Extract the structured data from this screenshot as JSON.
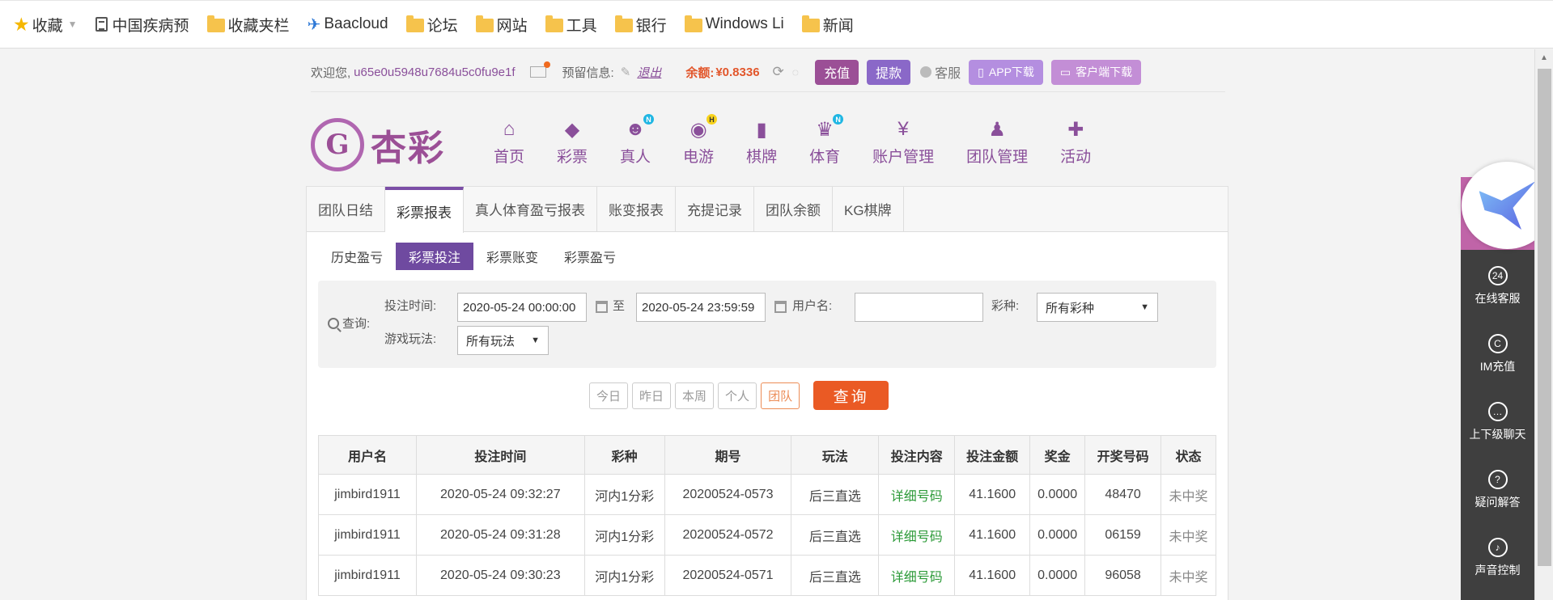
{
  "bookmarks": [
    {
      "label": "收藏",
      "type": "star"
    },
    {
      "label": "中国疾病预",
      "type": "doc"
    },
    {
      "label": "收藏夹栏",
      "type": "folder"
    },
    {
      "label": "Baacloud",
      "type": "plane"
    },
    {
      "label": "论坛",
      "type": "folder"
    },
    {
      "label": "网站",
      "type": "folder"
    },
    {
      "label": "工具",
      "type": "folder"
    },
    {
      "label": "银行",
      "type": "folder"
    },
    {
      "label": "Windows Li",
      "type": "folder"
    },
    {
      "label": "新闻",
      "type": "folder"
    }
  ],
  "topbar": {
    "welcome": "欢迎您,",
    "username": "u65e0u5948u7684u5c0fu9e1f",
    "reserve": "预留信息:",
    "logout": "退出",
    "balance_label": "余额:",
    "balance": "¥0.8336",
    "recharge": "充值",
    "withdraw": "提款",
    "service": "客服",
    "app_download": "APP下载",
    "client_download": "客户端下载"
  },
  "logo": {
    "text": "杏彩"
  },
  "nav": [
    "首页",
    "彩票",
    "真人",
    "电游",
    "棋牌",
    "体育",
    "账户管理",
    "团队管理",
    "活动"
  ],
  "nav_badges": {
    "zhenren": "N",
    "dianyou": "H",
    "tiyu": "N"
  },
  "tabs": [
    "团队日结",
    "彩票报表",
    "真人体育盈亏报表",
    "账变报表",
    "充提记录",
    "团队余额",
    "KG棋牌"
  ],
  "subtabs": [
    "历史盈亏",
    "彩票投注",
    "彩票账变",
    "彩票盈亏"
  ],
  "query": {
    "label": "查询:",
    "bet_time_label": "投注时间:",
    "start": "2020-05-24 00:00:00",
    "to": "至",
    "end": "2020-05-24 23:59:59",
    "username_label": "用户名:",
    "username_value": "",
    "lottery_label": "彩种:",
    "lottery_value": "所有彩种",
    "play_label": "游戏玩法:",
    "play_value": "所有玩法"
  },
  "quick": [
    "今日",
    "昨日",
    "本周",
    "个人",
    "团队"
  ],
  "search_btn": "查询",
  "table": {
    "headers": [
      "用户名",
      "投注时间",
      "彩种",
      "期号",
      "玩法",
      "投注内容",
      "投注金额",
      "奖金",
      "开奖号码",
      "状态"
    ],
    "rows": [
      [
        "jimbird1911",
        "2020-05-24 09:32:27",
        "河内1分彩",
        "20200524-0573",
        "后三直选",
        "详细号码",
        "41.1600",
        "0.0000",
        "48470",
        "未中奖"
      ],
      [
        "jimbird1911",
        "2020-05-24 09:31:28",
        "河内1分彩",
        "20200524-0572",
        "后三直选",
        "详细号码",
        "41.1600",
        "0.0000",
        "06159",
        "未中奖"
      ],
      [
        "jimbird1911",
        "2020-05-24 09:30:23",
        "河内1分彩",
        "20200524-0571",
        "后三直选",
        "详细号码",
        "41.1600",
        "0.0000",
        "96058",
        "未中奖"
      ]
    ]
  },
  "right_panel": [
    {
      "label": "在线客服",
      "icon": "24"
    },
    {
      "label": "IM充值",
      "icon": "C"
    },
    {
      "label": "上下级聊天",
      "icon": "…"
    },
    {
      "label": "疑问解答",
      "icon": "?"
    },
    {
      "label": "声音控制",
      "icon": "♪"
    }
  ]
}
